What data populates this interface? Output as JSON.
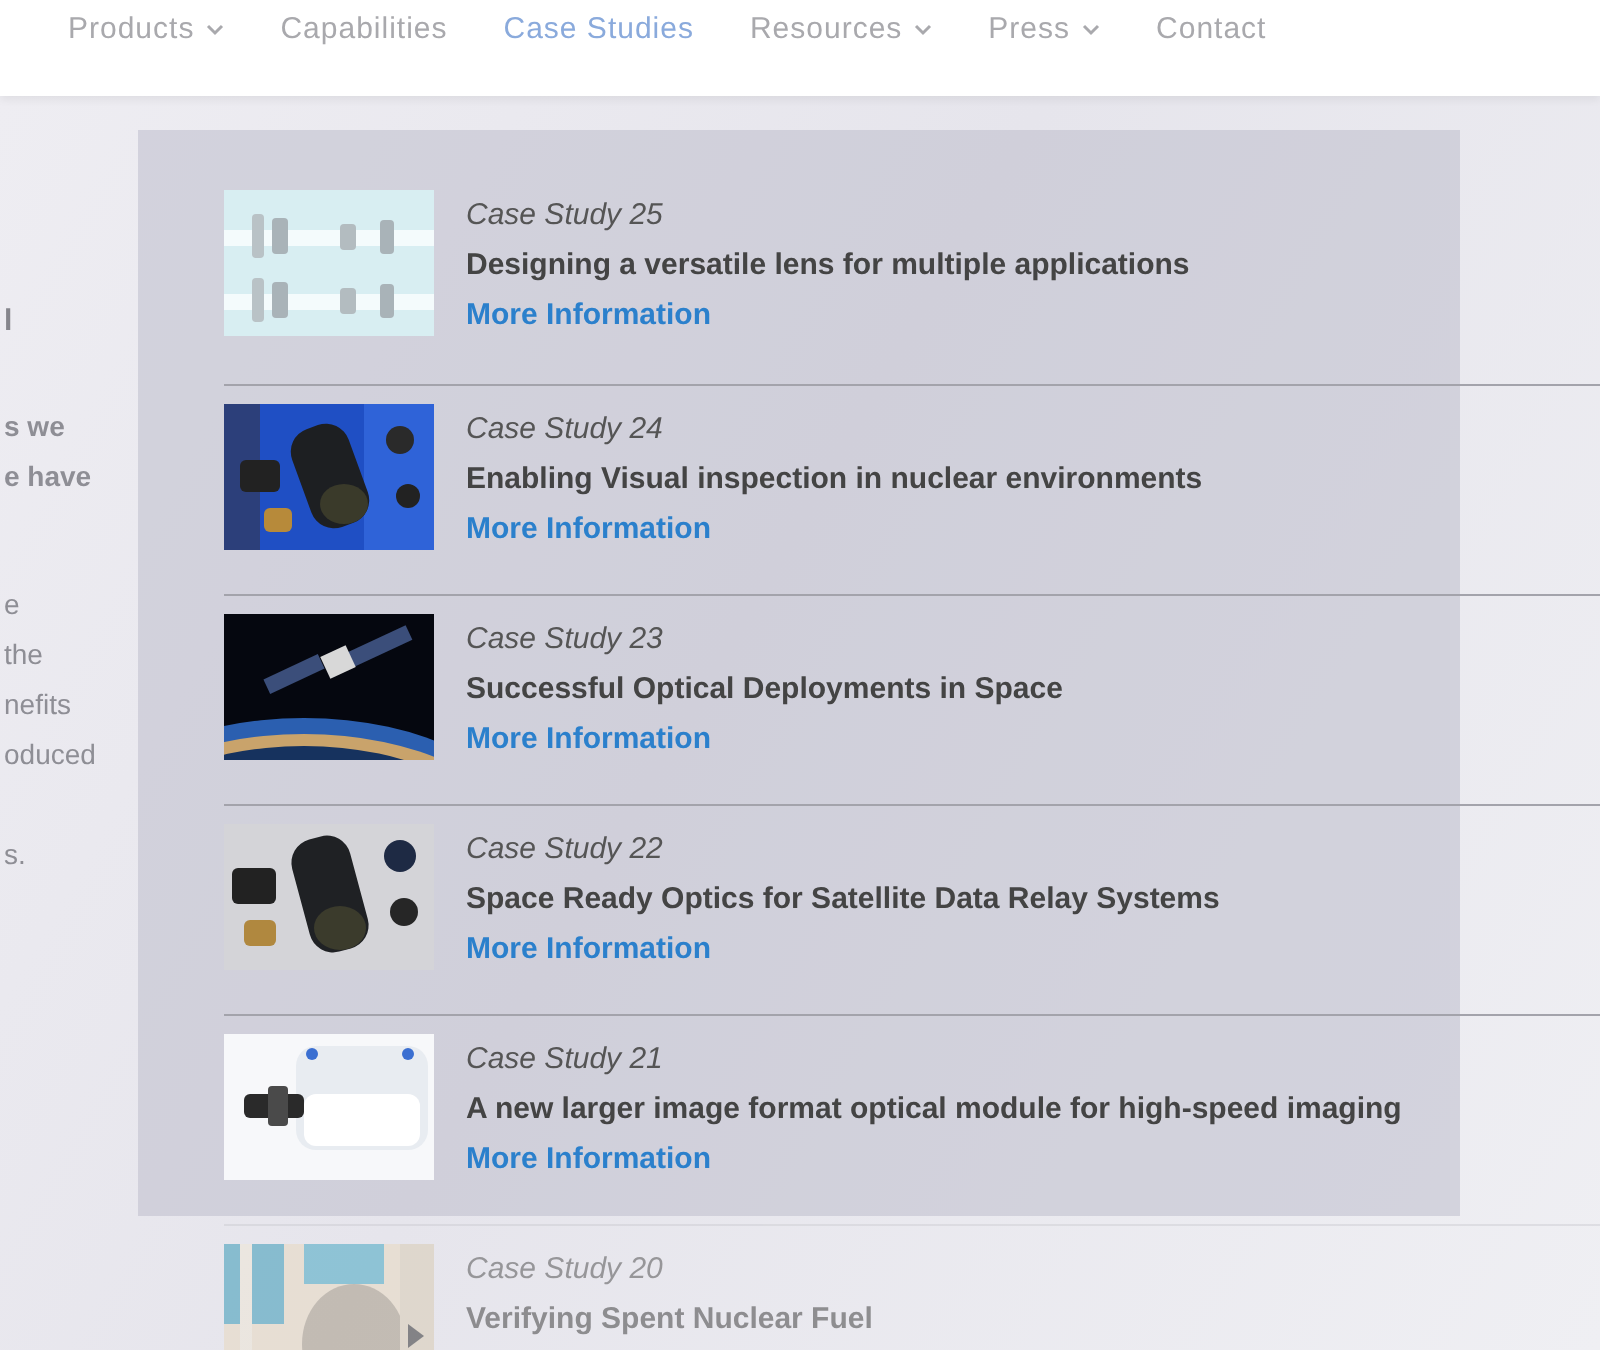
{
  "nav": [
    {
      "label": "Products",
      "has_menu": true,
      "selected": false
    },
    {
      "label": "Capabilities",
      "has_menu": false,
      "selected": false
    },
    {
      "label": "Case Studies",
      "has_menu": false,
      "selected": true
    },
    {
      "label": "Resources",
      "has_menu": true,
      "selected": false
    },
    {
      "label": "Press",
      "has_menu": true,
      "selected": false
    },
    {
      "label": "Contact",
      "has_menu": false,
      "selected": false
    }
  ],
  "side_text": [
    [
      "l"
    ],
    [
      "s we",
      "e have"
    ],
    [
      "e",
      "the",
      "nefits",
      "oduced"
    ],
    [
      "s."
    ]
  ],
  "case_studies": [
    {
      "kicker": "Case Study 25",
      "title": "Designing a versatile lens for multiple applications",
      "link": "More Information",
      "faded": false
    },
    {
      "kicker": "Case Study 24",
      "title": "Enabling Visual inspection in nuclear environments",
      "link": "More Information",
      "faded": false
    },
    {
      "kicker": "Case Study 23",
      "title": "Successful Optical Deployments in Space",
      "link": "More Information",
      "faded": false
    },
    {
      "kicker": "Case Study 22",
      "title": "Space Ready Optics for Satellite Data Relay Systems",
      "link": "More Information",
      "faded": false
    },
    {
      "kicker": "Case Study 21",
      "title": "A new larger image format optical module for high-speed imaging",
      "link": "More Information",
      "faded": false
    },
    {
      "kicker": "Case Study 20",
      "title": "Verifying Spent Nuclear Fuel",
      "faded": true
    }
  ]
}
